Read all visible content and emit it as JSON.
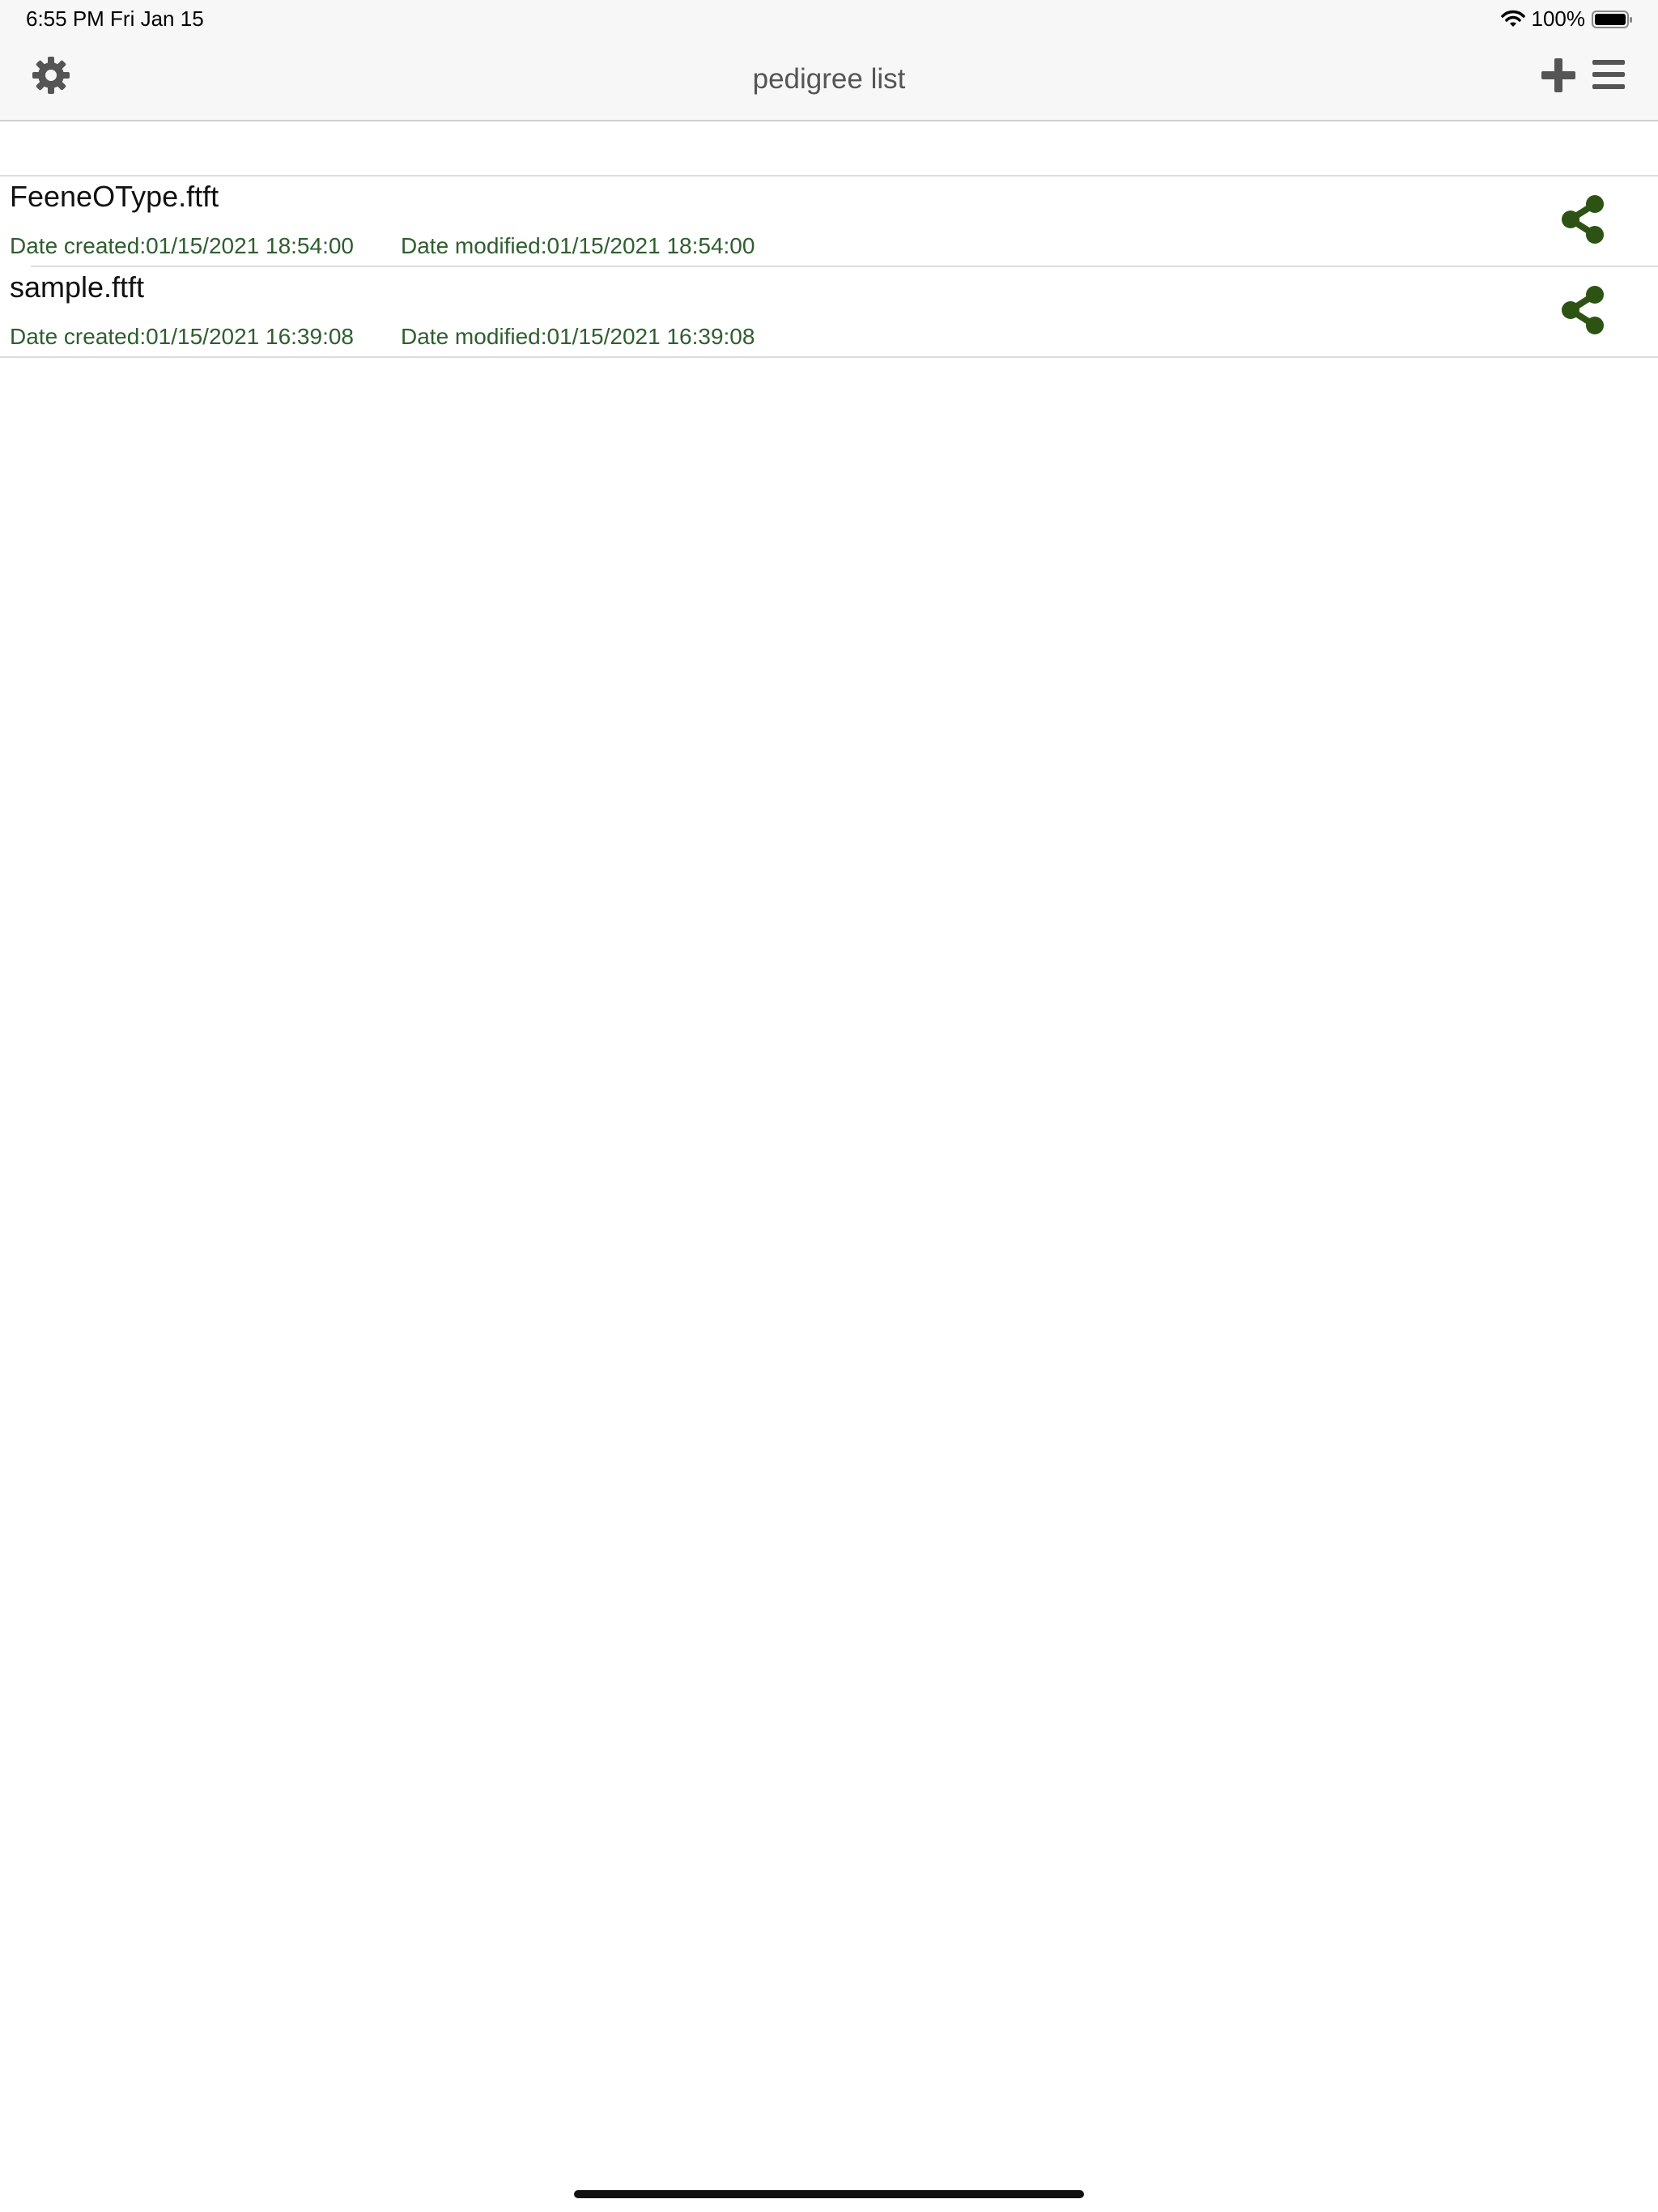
{
  "status_bar": {
    "time": "6:55 PM   Fri Jan 15",
    "battery": "100%"
  },
  "nav": {
    "title": "pedigree list"
  },
  "icons": {
    "settings": "gear-icon",
    "add": "plus-icon",
    "menu": "hamburger-menu-icon",
    "share": "share-icon"
  },
  "colors": {
    "date_text": "#2f5e2f",
    "share_icon": "#2d5314",
    "toolbar_icon": "#555555"
  },
  "files": [
    {
      "name": "FeeneOType.ftft",
      "created": "Date created:01/15/2021 18:54:00",
      "modified": "Date modified:01/15/2021 18:54:00"
    },
    {
      "name": "sample.ftft",
      "created": "Date created:01/15/2021 16:39:08",
      "modified": "Date modified:01/15/2021 16:39:08"
    }
  ]
}
